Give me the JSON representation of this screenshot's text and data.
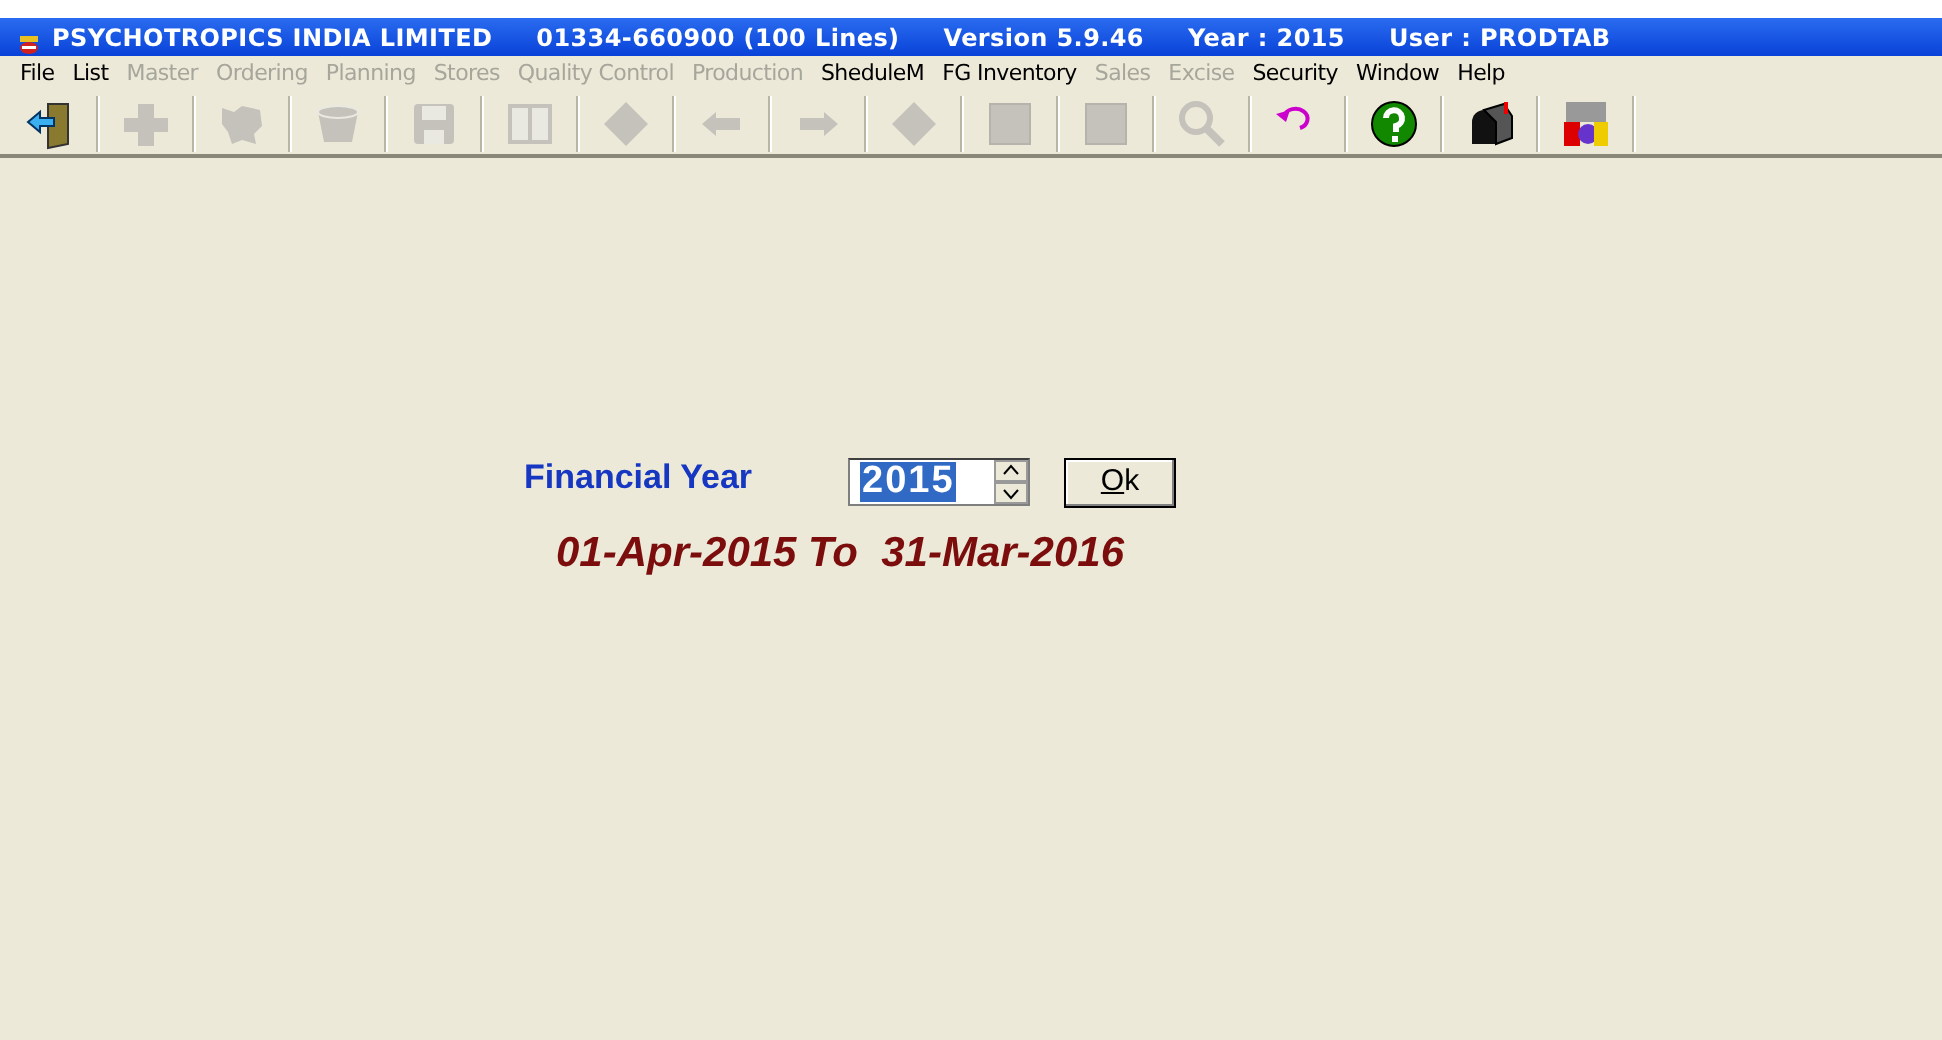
{
  "window": {
    "title_parts": [
      "PSYCHOTROPICS INDIA LIMITED",
      "01334-660900 (100 Lines)",
      "Version 5.9.46",
      "Year : 2015",
      "User : PRODTAB"
    ]
  },
  "menu": [
    {
      "label": "File",
      "disabled": false
    },
    {
      "label": "List",
      "disabled": false
    },
    {
      "label": "Master",
      "disabled": true
    },
    {
      "label": "Ordering",
      "disabled": true
    },
    {
      "label": "Planning",
      "disabled": true
    },
    {
      "label": "Stores",
      "disabled": true
    },
    {
      "label": "Quality Control",
      "disabled": true
    },
    {
      "label": "Production",
      "disabled": true
    },
    {
      "label": "SheduleM",
      "disabled": false
    },
    {
      "label": "FG Inventory",
      "disabled": false
    },
    {
      "label": "Sales",
      "disabled": true
    },
    {
      "label": "Excise",
      "disabled": true
    },
    {
      "label": "Security",
      "disabled": false
    },
    {
      "label": "Window",
      "disabled": false
    },
    {
      "label": "Help",
      "disabled": false
    }
  ],
  "toolbar": [
    {
      "kind": "exit",
      "disabled": false
    },
    {
      "kind": "add",
      "disabled": true
    },
    {
      "kind": "map",
      "disabled": true
    },
    {
      "kind": "basket",
      "disabled": true
    },
    {
      "kind": "save",
      "disabled": true
    },
    {
      "kind": "book",
      "disabled": true
    },
    {
      "kind": "diamond",
      "disabled": true
    },
    {
      "kind": "back",
      "disabled": true
    },
    {
      "kind": "forward",
      "disabled": true
    },
    {
      "kind": "diamond",
      "disabled": true
    },
    {
      "kind": "square",
      "disabled": true
    },
    {
      "kind": "square",
      "disabled": true
    },
    {
      "kind": "search",
      "disabled": true
    },
    {
      "kind": "undo",
      "disabled": false
    },
    {
      "kind": "help",
      "disabled": false
    },
    {
      "kind": "mailbox",
      "disabled": false
    },
    {
      "kind": "msdos",
      "disabled": false
    }
  ],
  "form": {
    "label": "Financial Year",
    "year_field": {
      "value": "2015",
      "text_selected": true
    },
    "ok_button": {
      "label": "Ok",
      "first_letter_underlined": true
    },
    "period": "01-Apr-2015 To  31-Mar-2016"
  }
}
